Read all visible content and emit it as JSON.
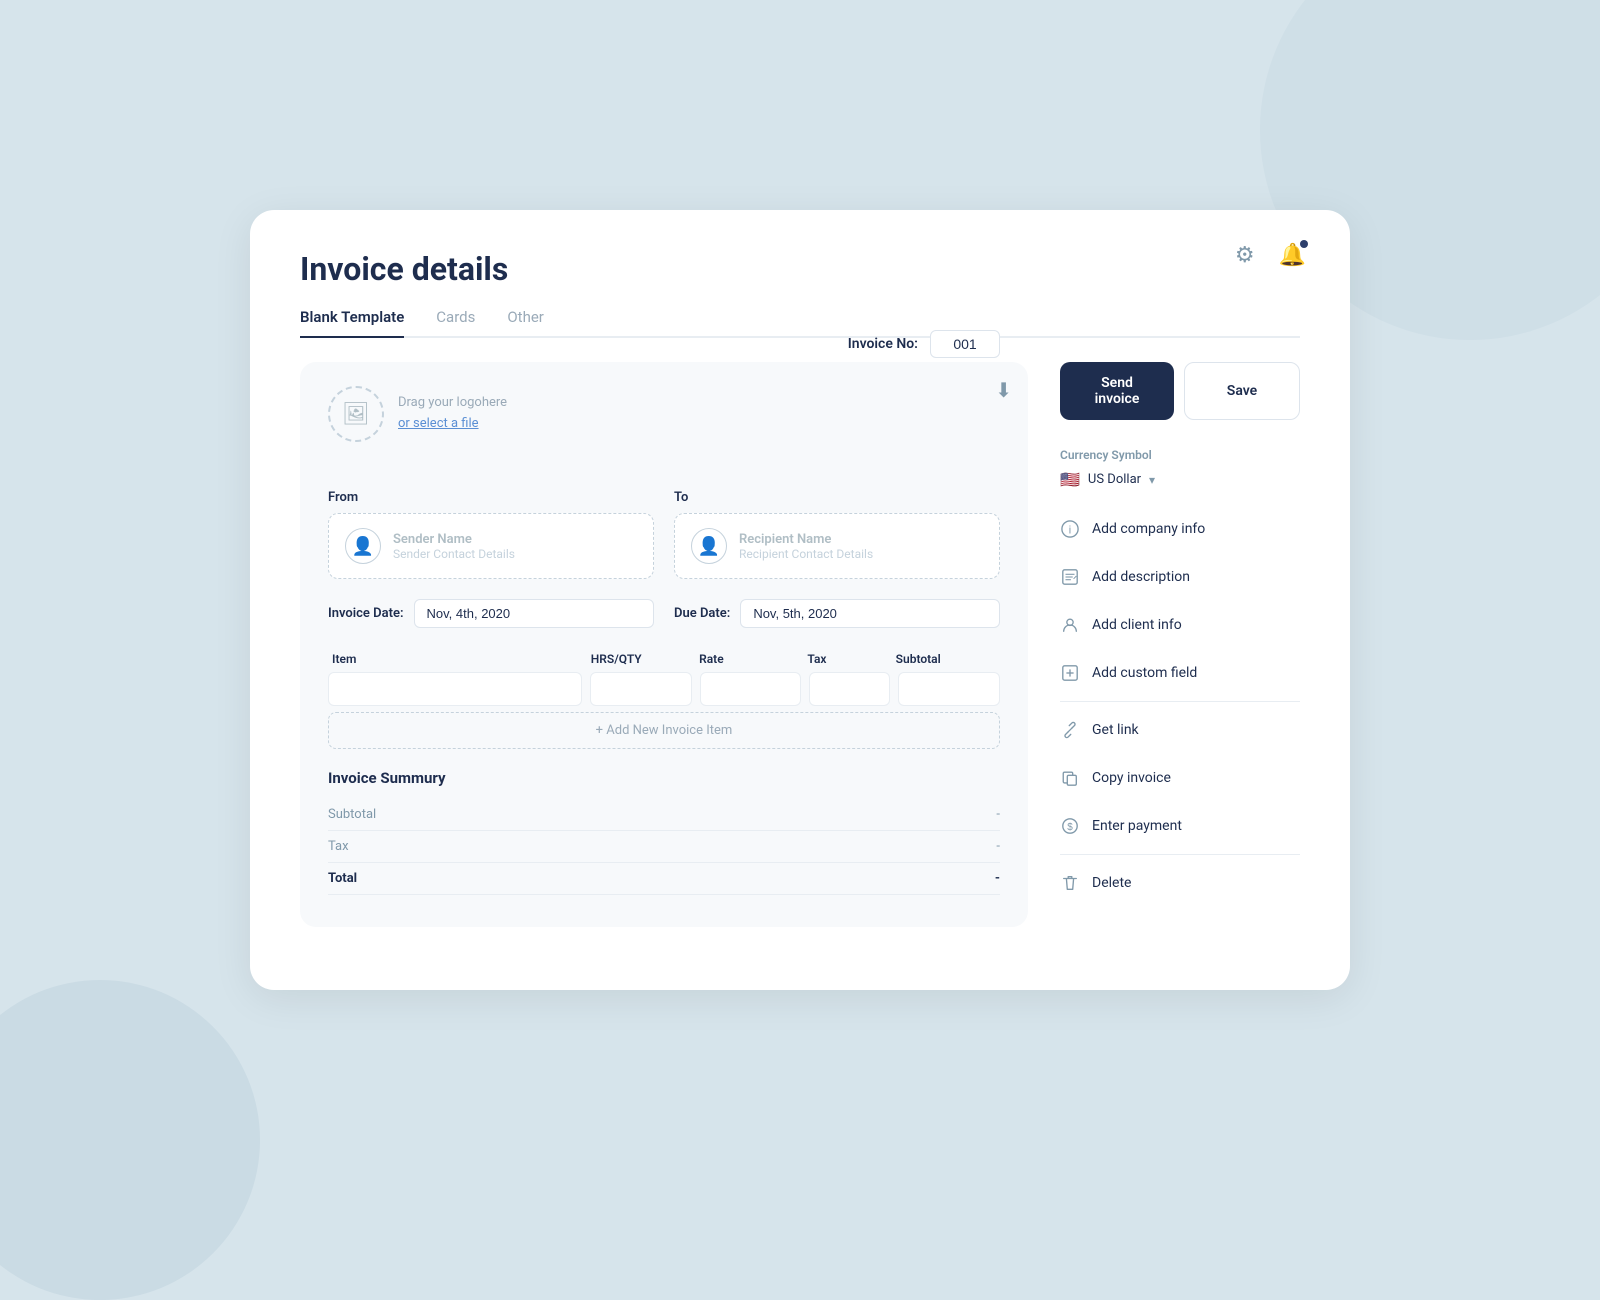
{
  "page": {
    "title": "Invoice details"
  },
  "tabs": [
    {
      "id": "blank",
      "label": "Blank Template",
      "active": true
    },
    {
      "id": "cards",
      "label": "Cards",
      "active": false
    },
    {
      "id": "other",
      "label": "Other",
      "active": false
    }
  ],
  "toolbar": {
    "send_label": "Send invoice",
    "save_label": "Save"
  },
  "icons": {
    "gear": "⚙",
    "bell": "🔔",
    "download": "⬇",
    "user": "👤",
    "image": "🖼"
  },
  "invoice": {
    "logo_drag_text": "Drag your logohere",
    "logo_select_text": "or select a file",
    "invoice_no_label": "Invoice No:",
    "invoice_no_value": "001",
    "from_label": "From",
    "to_label": "To",
    "sender_name": "Sender Name",
    "sender_details": "Sender Contact Details",
    "recipient_name": "Recipient Name",
    "recipient_details": "Recipient Contact Details",
    "invoice_date_label": "Invoice Date:",
    "invoice_date_value": "Nov, 4th, 2020",
    "due_date_label": "Due Date:",
    "due_date_value": "Nov, 5th, 2020",
    "table_headers": {
      "item": "Item",
      "hrs_qty": "HRS/QTY",
      "rate": "Rate",
      "tax": "Tax",
      "subtotal": "Subtotal"
    },
    "add_item_label": "+ Add New Invoice Item",
    "summary_title": "Invoice Summury",
    "summary_rows": [
      {
        "label": "Subtotal",
        "value": "-"
      },
      {
        "label": "Tax",
        "value": "-"
      },
      {
        "label": "Total",
        "value": "-"
      }
    ]
  },
  "currency": {
    "section_label": "Currency Symbol",
    "flag": "🇺🇸",
    "name": "US Dollar",
    "chevron": "▾"
  },
  "sidebar_actions": [
    {
      "id": "company-info",
      "icon": "ℹ",
      "label": "Add company info",
      "divider_above": false
    },
    {
      "id": "description",
      "icon": "✏",
      "label": "Add description",
      "divider_above": false
    },
    {
      "id": "client-info",
      "icon": "👤",
      "label": "Add client info",
      "divider_above": false
    },
    {
      "id": "custom-field",
      "icon": "📋",
      "label": "Add custom field",
      "divider_above": false
    },
    {
      "id": "get-link",
      "icon": "🔗",
      "label": "Get link",
      "divider_above": true
    },
    {
      "id": "copy-invoice",
      "icon": "📄",
      "label": "Copy invoice",
      "divider_above": false
    },
    {
      "id": "enter-payment",
      "icon": "💲",
      "label": "Enter payment",
      "divider_above": false
    },
    {
      "id": "delete",
      "icon": "🗑",
      "label": "Delete",
      "divider_above": true
    }
  ]
}
